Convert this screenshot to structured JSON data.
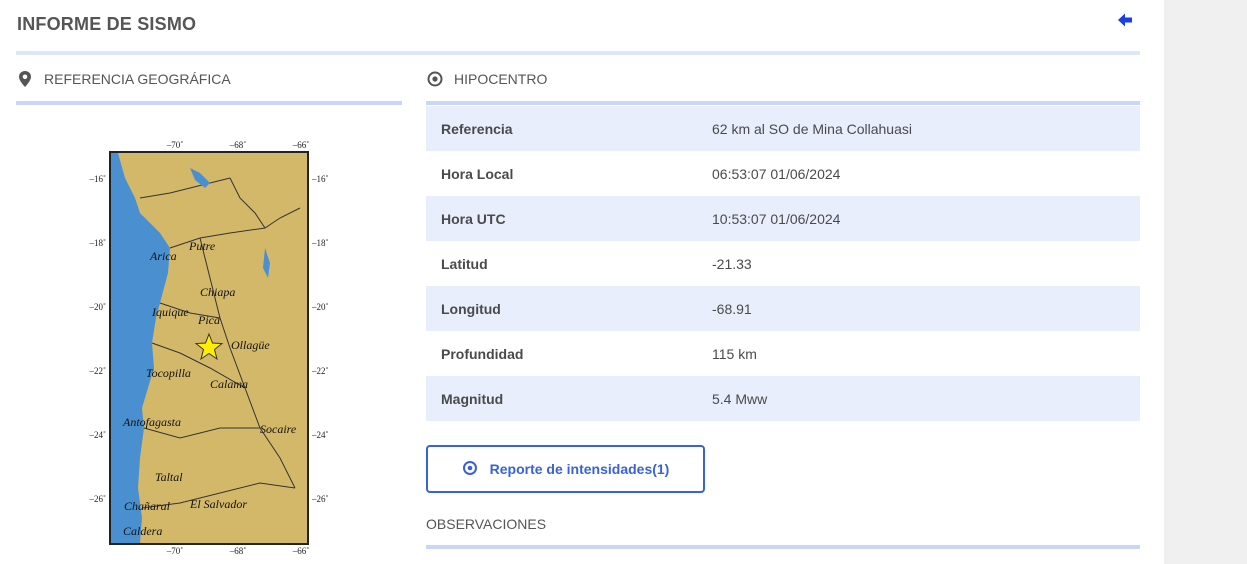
{
  "header": {
    "title": "INFORME DE SISMO"
  },
  "geo_section": {
    "title": "REFERENCIA GEOGRÁFICA"
  },
  "hipo_section": {
    "title": "HIPOCENTRO",
    "rows": [
      {
        "label": "Referencia",
        "value": "62 km al SO de Mina Collahuasi"
      },
      {
        "label": "Hora Local",
        "value": "06:53:07 01/06/2024"
      },
      {
        "label": "Hora UTC",
        "value": "10:53:07 01/06/2024"
      },
      {
        "label": "Latitud",
        "value": "-21.33"
      },
      {
        "label": "Longitud",
        "value": "-68.91"
      },
      {
        "label": "Profundidad",
        "value": "115 km"
      },
      {
        "label": "Magnitud",
        "value": "5.4 Mww"
      }
    ]
  },
  "report_button": {
    "label": "Reporte de intensidades(1)"
  },
  "observations": {
    "title": "OBSERVACIONES"
  },
  "map": {
    "x_ticks": [
      "–70˚",
      "–68˚",
      "–66˚"
    ],
    "y_ticks": [
      "–16˚",
      "–18˚",
      "–20˚",
      "–22˚",
      "–24˚",
      "–26˚"
    ],
    "places": [
      "Putre",
      "Arica",
      "Chiapa",
      "Iquique",
      "Pica",
      "Ollagüe",
      "Tocopilla",
      "Calama",
      "Antofagasta",
      "Socaire",
      "Taltal",
      "Chañaral",
      "El Salvador",
      "Caldera"
    ],
    "epicenter": {
      "lon": -68.91,
      "lat": -21.33
    },
    "colors": {
      "sea": "#4a90d0",
      "land": "#d4b86a",
      "star": "#ffee00"
    }
  },
  "colors": {
    "accent": "#3a62d6",
    "row_alt": "#e8eefc",
    "rule": "#c9d6f5",
    "back_arrow": "#1a3ee8"
  }
}
